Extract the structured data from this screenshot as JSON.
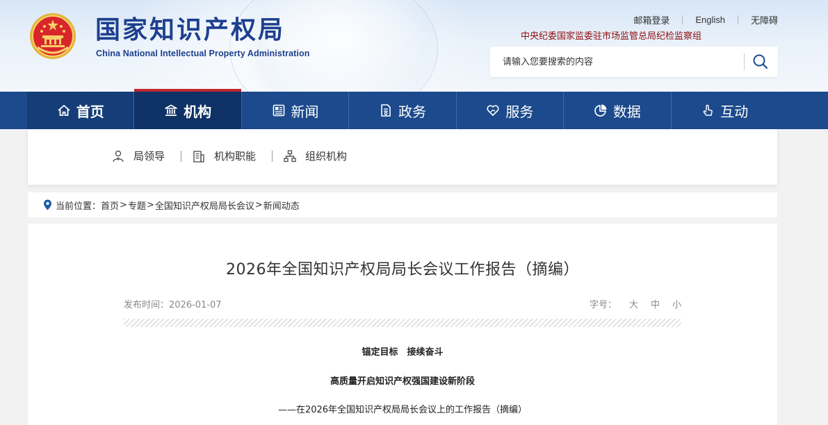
{
  "header": {
    "org_name_cn": "国家知识产权局",
    "org_name_en": "China National Intellectual Property Administration",
    "top_links": [
      "邮箱登录",
      "English",
      "无障碍"
    ],
    "supervision_text": "中央纪委国家监委驻市场监管总局纪检监察组",
    "search": {
      "placeholder": "请输入您要搜索的内容"
    }
  },
  "nav": {
    "items": [
      {
        "label": "首页",
        "icon": "home-icon"
      },
      {
        "label": "机构",
        "icon": "institution-icon",
        "active": true
      },
      {
        "label": "新闻",
        "icon": "news-icon"
      },
      {
        "label": "政务",
        "icon": "document-icon"
      },
      {
        "label": "服务",
        "icon": "heart-hand-icon"
      },
      {
        "label": "数据",
        "icon": "pie-chart-icon"
      },
      {
        "label": "互动",
        "icon": "touch-icon"
      }
    ]
  },
  "submenu": {
    "items": [
      {
        "label": "局领导",
        "icon": "person-icon"
      },
      {
        "label": "机构职能",
        "icon": "building-icon"
      },
      {
        "label": "组织机构",
        "icon": "org-chart-icon"
      }
    ]
  },
  "breadcrumb": {
    "prefix": "当前位置：",
    "items": [
      "首页",
      "专题",
      "全国知识产权局局长会议",
      "新闻动态"
    ],
    "separator": ">"
  },
  "article": {
    "title": "2026年全国知识产权局局长会议工作报告（摘编）",
    "publish_label": "发布时间：",
    "publish_date": "2026-01-07",
    "font_size_label": "字号：",
    "font_size_options": [
      "大",
      "中",
      "小"
    ],
    "paragraphs": [
      "锚定目标　接续奋斗",
      "高质量开启知识产权强国建设新阶段",
      "——在2026年全国知识产权局局长会议上的工作报告（摘编）"
    ]
  },
  "colors": {
    "nav_bg": "#1c4a8c",
    "nav_active_bg": "#0e3266",
    "nav_active_bar": "#c0262d",
    "brand_blue": "#1d3f8f",
    "supervision_red": "#8e0e0e"
  }
}
